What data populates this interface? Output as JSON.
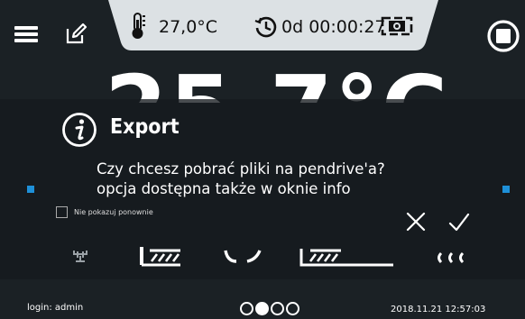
{
  "topbar": {
    "menu_icon": "hamburger-icon",
    "edit_icon": "edit-icon",
    "temperature_icon": "thermometer-icon",
    "temperature": "27,0°C",
    "timer_icon": "clock-icon",
    "timer": "0d 00:00:27",
    "camera_icon": "camera-icon",
    "stop_icon": "stop-icon"
  },
  "background": {
    "big_temperature": "25.7°C"
  },
  "dialog": {
    "icon": "info-icon",
    "title": "Export",
    "message_line1": "Czy chcesz pobrać pliki na pendrive'a?",
    "message_line2": "opcja dostępna także w oknie info",
    "checkbox_label": "Nie pokazuj ponownie",
    "checkbox_checked": false,
    "cancel_icon": "x-icon",
    "confirm_icon": "check-icon"
  },
  "program_icons": [
    "fan-icon",
    "heating-ramp-icon",
    "cooling-icon",
    "long-ramp-icon",
    "waves-icon"
  ],
  "footer": {
    "login": "login: admin",
    "datetime": "2018.11.21 12:57:03",
    "pages": 4,
    "active_page": 2
  },
  "colors": {
    "background": "#1b2125",
    "accent": "#1e90d8",
    "status_pill": "#dce1e4"
  }
}
